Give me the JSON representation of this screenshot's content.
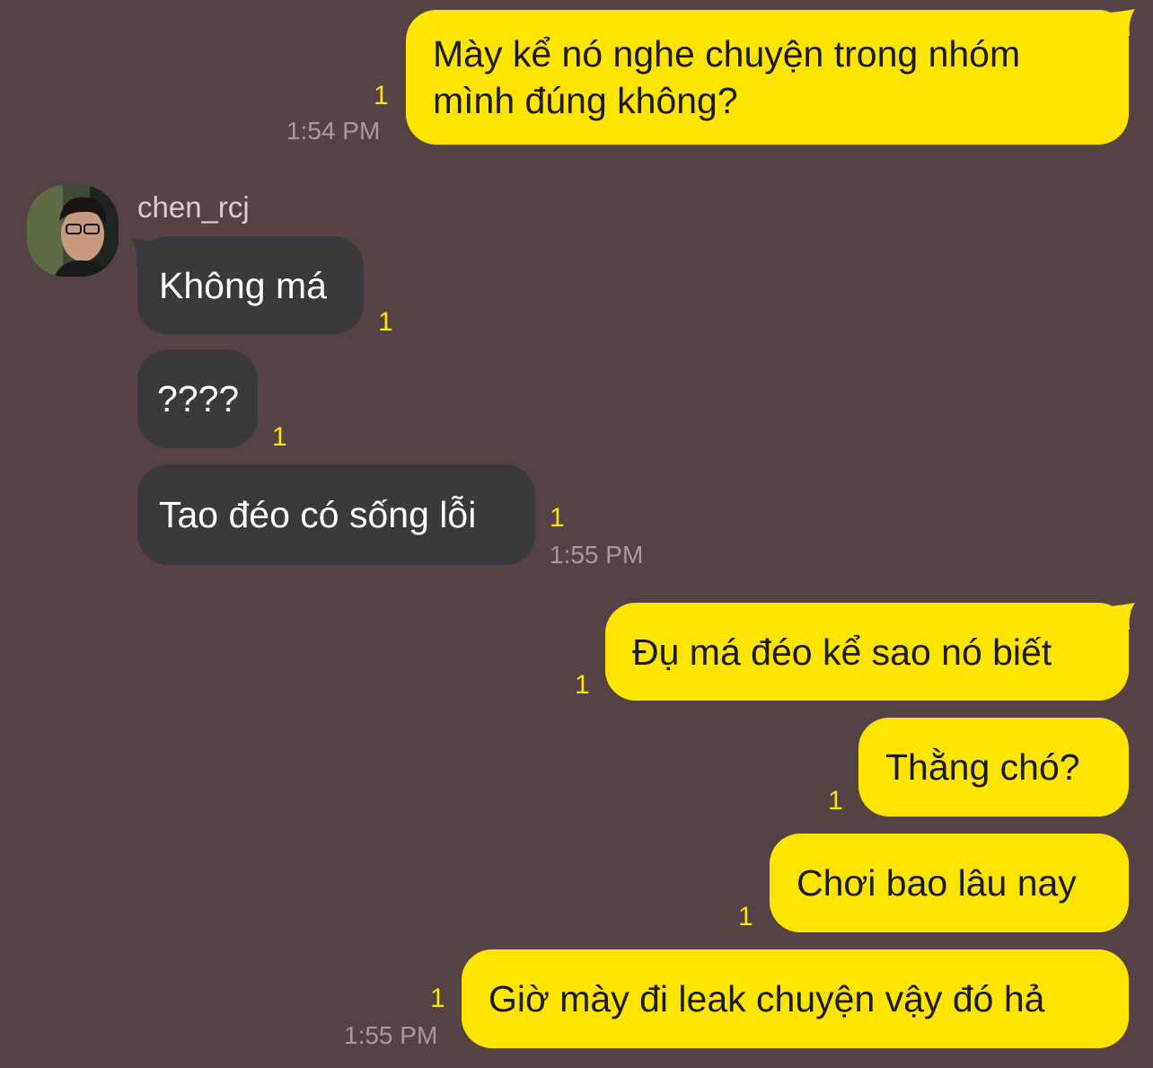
{
  "contact": {
    "name": "chen_rcj",
    "avatar_icon": "user-photo-avatar"
  },
  "colors": {
    "background": "#554244",
    "outgoing_bubble": "#FEE500",
    "incoming_bubble": "#3a393c",
    "unread": "#FEE500"
  },
  "messages": [
    {
      "id": "m1",
      "direction": "outgoing",
      "text": "Mày kể nó nghe chuyện trong nhóm mình đúng không?",
      "unread": "1",
      "time": "1:54 PM"
    },
    {
      "id": "m2",
      "direction": "incoming",
      "text": "Không má",
      "unread": "1"
    },
    {
      "id": "m3",
      "direction": "incoming",
      "text": "????",
      "unread": "1"
    },
    {
      "id": "m4",
      "direction": "incoming",
      "text": "Tao đéo có sống lỗi",
      "unread": "1",
      "time": "1:55 PM"
    },
    {
      "id": "m5",
      "direction": "outgoing",
      "text": "Đụ má đéo kể sao nó biết",
      "unread": "1"
    },
    {
      "id": "m6",
      "direction": "outgoing",
      "text": "Thằng chó?",
      "unread": "1"
    },
    {
      "id": "m7",
      "direction": "outgoing",
      "text": "Chơi bao lâu nay",
      "unread": "1"
    },
    {
      "id": "m8",
      "direction": "outgoing",
      "text": "Giờ mày đi leak chuyện vậy đó hả",
      "unread": "1",
      "time": "1:55 PM"
    }
  ]
}
